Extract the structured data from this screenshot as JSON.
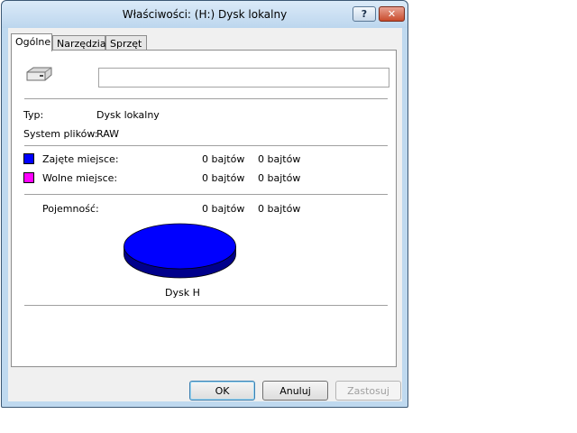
{
  "window": {
    "title": "Właściwości: (H:) Dysk lokalny",
    "help_label": "?",
    "close_label": "✕"
  },
  "tabs": [
    {
      "label": "Ogólne",
      "active": true
    },
    {
      "label": "Narzędzia",
      "active": false
    },
    {
      "label": "Sprzęt",
      "active": false
    }
  ],
  "general": {
    "volume_name": "",
    "type_label": "Typ:",
    "type_value": "Dysk lokalny",
    "fs_label": "System plików:",
    "fs_value": "RAW",
    "used_label": "Zajęte miejsce:",
    "used_bytes": "0 bajtów",
    "used_size": "0 bajtów",
    "free_label": "Wolne miejsce:",
    "free_bytes": "0 bajtów",
    "free_size": "0 bajtów",
    "capacity_label": "Pojemność:",
    "capacity_bytes": "0 bajtów",
    "capacity_size": "0 bajtów",
    "disk_label": "Dysk H"
  },
  "colors": {
    "used": "#0000ff",
    "free": "#ff00ff"
  },
  "buttons": {
    "ok": "OK",
    "cancel": "Anuluj",
    "apply": "Zastosuj"
  }
}
